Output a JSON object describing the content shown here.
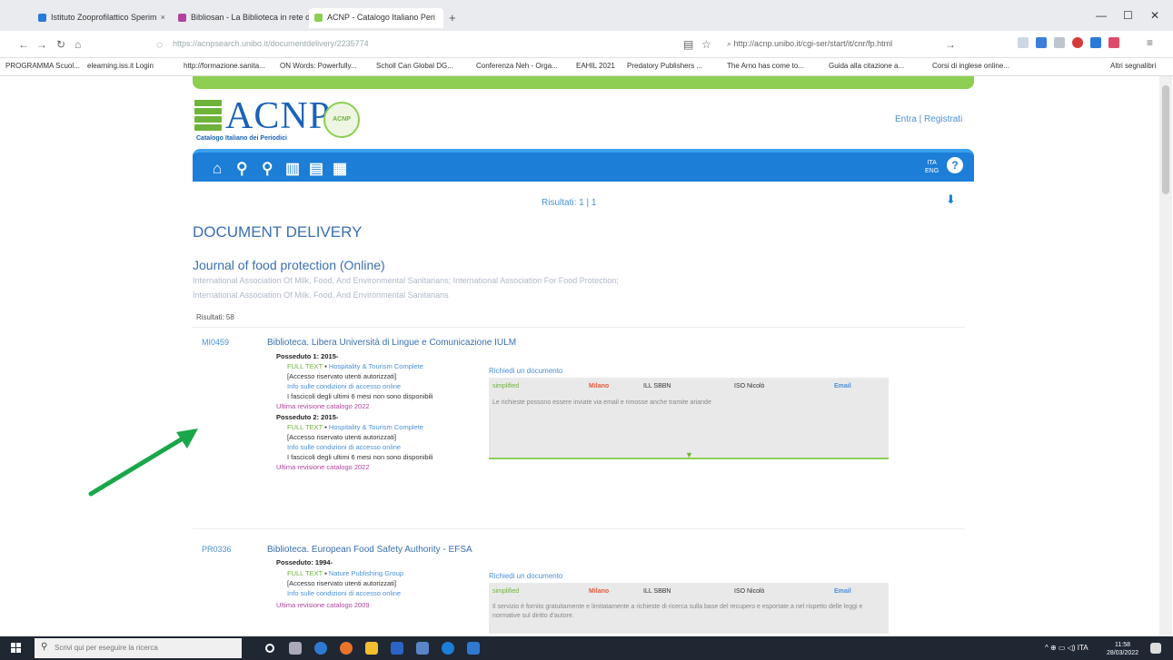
{
  "browser": {
    "tabs": [
      {
        "label": "Istituto Zooprofilattico Sperim",
        "favicon_color": "#2a7ad9"
      },
      {
        "label": "Bibliosan - La Biblioteca in rete d",
        "favicon_color": "#b0449c"
      },
      {
        "label": "ACNP - Catalogo Italiano Peri",
        "favicon_color": "#8ccf52",
        "active": true
      }
    ],
    "new_tab": "+",
    "url": "https://acnpsearch.unibo.it/documentdelivery/2235774",
    "url_domain": "unibo.it",
    "search_text": "http://acnp.unibo.it/cgi-ser/start/it/cnr/fp.html",
    "bookmarks": [
      "PROGRAMMA Scuol...",
      "elearning.iss.it Login",
      "http://formazione.sanita...",
      "ON Words: Powerfully...",
      "Scholl Can Global DG...",
      "Conferenza Neh - Orga...",
      "EAHIL 2021",
      "Predatory Publishers ...",
      "The Arno has come to...",
      "Guida alla citazione a...",
      "Corsi di inglese online...",
      "Altri segnalibri"
    ]
  },
  "site": {
    "logo": "ACNP",
    "logo_seal": "ACNP",
    "logo_subtitle": "Catalogo Italiano dei Periodici",
    "login": "Entra | Registrati",
    "nav_icons": [
      "home-icon",
      "search-icon",
      "map-pin-icon",
      "barcode-icon",
      "document-icon",
      "qr-icon"
    ],
    "lang": [
      "ITA",
      "ENG"
    ],
    "help": "?",
    "results_nav": "Risultati: 1 | 1",
    "page_title": "DOCUMENT DELIVERY",
    "journal_title": "Journal of food protection (Online)",
    "publishers": [
      "International Association Of Milk, Food, And Environmental Sanitarians; International Association For Food Protection;",
      "International Association Of Milk, Food, And Environmental Sanitarians"
    ],
    "results_count": "Risultati: 58"
  },
  "libraries": [
    {
      "code": "MI0459",
      "name": "Biblioteca. Libera Università di Lingue e Comunicazione IULM",
      "holdings": [
        {
          "posseduto": "Posseduto 1: 2015-",
          "fulltext": "FULL TEXT",
          "provider": "Hospitality & Tourism Complete",
          "access": "[Accesso riservato utenti autorizzati]",
          "info": "Info sulle condizioni di accesso online",
          "note": "I fascicoli degli ultimi 6 mesi non sono disponibili",
          "revision": "Ultima revisione catalogo 2022"
        },
        {
          "posseduto": "Posseduto 2: 2015-",
          "fulltext": "FULL TEXT",
          "provider": "Hospitality & Tourism Complete",
          "access": "[Accesso riservato utenti autorizzati]",
          "info": "Info sulle condizioni di accesso online",
          "note": "I fascicoli degli ultimi 6 mesi non sono disponibili",
          "revision": "Ultima revisione catalogo 2022"
        }
      ],
      "request_label": "Richiedi un documento",
      "request_cols": [
        "simplified",
        "Milano",
        "ILL SBBN",
        "ISO Nicolò",
        "Email"
      ],
      "request_note": "Le richieste possono essere inviate via email e rimosse anche tramite ariande"
    },
    {
      "code": "PR0336",
      "name": "Biblioteca. European Food Safety Authority - EFSA",
      "holdings": [
        {
          "posseduto": "Posseduto: 1994-",
          "fulltext": "FULL TEXT",
          "provider": "Nature Publishing Group",
          "access": "[Accesso riservato utenti autorizzati]",
          "info": "Info sulle condizioni di accesso online",
          "revision": "Ultima revisione catalogo 2009"
        }
      ],
      "request_label": "Richiedi un documento",
      "request_cols": [
        "simplified",
        "Milano",
        "ILL SBBN",
        "ISO Nicolò",
        "Email"
      ],
      "request_note": "Il servizio è fornito gratuitamente e limitatamente a richieste di ricerca sulla base del recupero e esportate a nel rispetto delle leggi e normative sul diritto d'autore."
    }
  ],
  "taskbar": {
    "search_placeholder": "Scrivi qui per eseguire la ricerca",
    "time": "11:58",
    "date": "28/03/2022",
    "systray": "^ ⊕ ▭ ◁) ITA"
  },
  "colors": {
    "green": "#8ccf52",
    "blue": "#1c7ed6",
    "arrow": "#1aa64a"
  }
}
